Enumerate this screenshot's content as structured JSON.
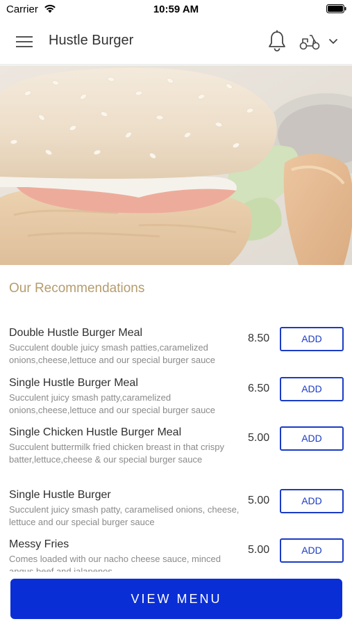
{
  "status_bar": {
    "carrier": "Carrier",
    "time": "10:59 AM",
    "icons": [
      "wifi-icon",
      "battery-icon"
    ]
  },
  "nav": {
    "title": "Hustle Burger",
    "icons": [
      "hamburger-menu-icon",
      "bell-icon",
      "scooter-icon",
      "chevron-down-icon"
    ]
  },
  "hero": {
    "image": "burger-and-potato-wedges-photo"
  },
  "recommendations": {
    "title": "Our Recommendations",
    "items": [
      {
        "name": "Double Hustle Burger Meal",
        "description": "Succulent double juicy smash patties,caramelized onions,cheese,lettuce and our special burger sauce",
        "price": "8.50",
        "add_label": "ADD"
      },
      {
        "name": "Single Hustle Burger Meal",
        "description": "Succulent juicy smash patty,caramelized onions,cheese,lettuce and our special burger sauce",
        "price": "6.50",
        "add_label": "ADD"
      },
      {
        "name": "Single Chicken Hustle Burger Meal",
        "description": "Succulent buttermilk fried chicken breast in that crispy batter,lettuce,cheese & our special burger sauce",
        "price": "5.00",
        "add_label": "ADD"
      },
      {
        "name": "Single Hustle Burger",
        "description": "Succulent juicy smash patty, caramelised onions, cheese, lettuce and our special burger sauce",
        "price": "5.00",
        "add_label": "ADD"
      },
      {
        "name": "Messy Fries",
        "description": "Comes loaded with our nacho cheese sauce, minced angus beef and jalapenos",
        "price": "5.00",
        "add_label": "ADD"
      }
    ]
  },
  "footer": {
    "view_menu_label": "VIEW MENU"
  },
  "colors": {
    "accent": "#0a2ed6",
    "button_outline": "#1a3bc4",
    "section_title": "#b59c6e"
  }
}
